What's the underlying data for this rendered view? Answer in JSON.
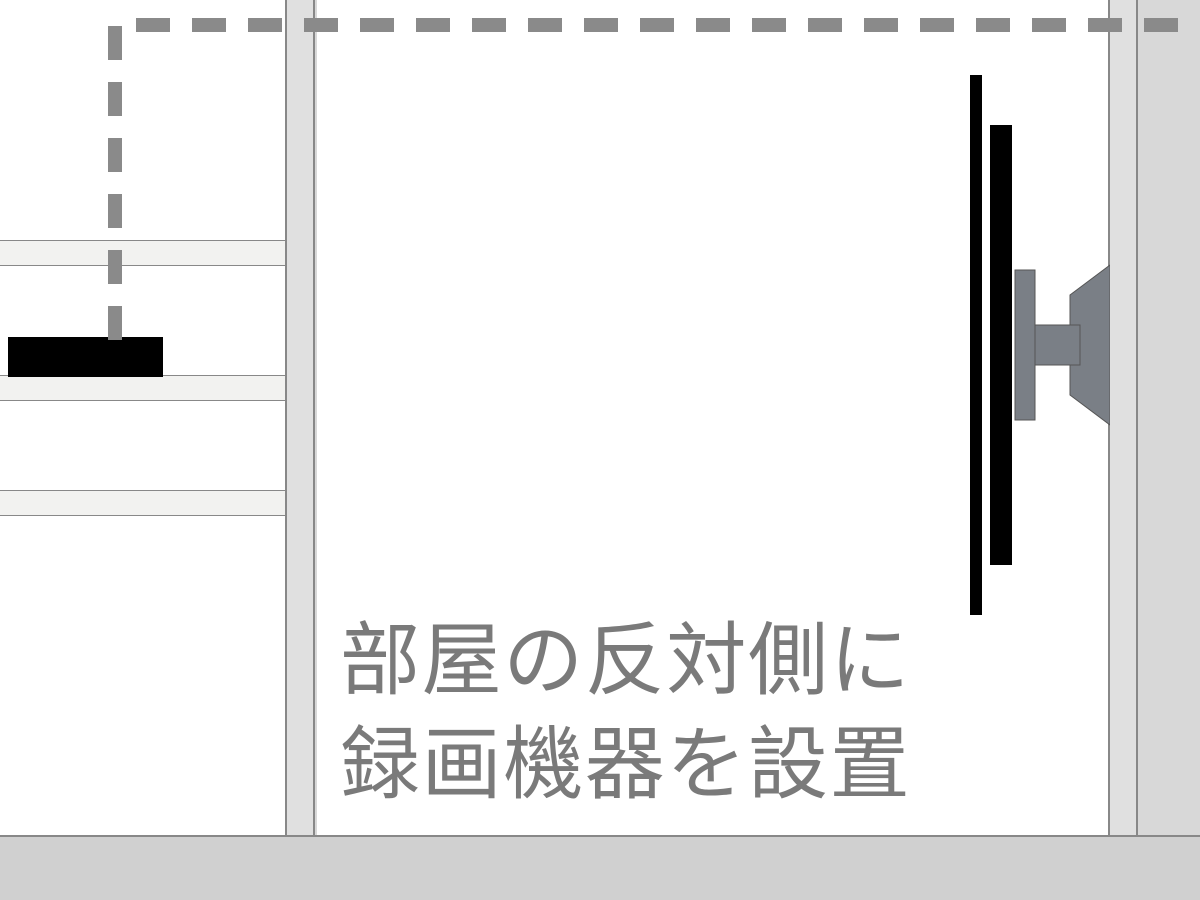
{
  "caption": {
    "line1": "部屋の反対側に",
    "line2": "録画機器を設置"
  },
  "elements": {
    "recorder_name": "recording-device",
    "tv_name": "wall-mounted-tv",
    "shelf_name": "shelf",
    "cable_name": "cable-route"
  },
  "colors": {
    "wall": "#e0e0e0",
    "background": "#d8d8d8",
    "text": "#7a7a7a",
    "device": "#000000",
    "mount": "#7a7f86"
  }
}
